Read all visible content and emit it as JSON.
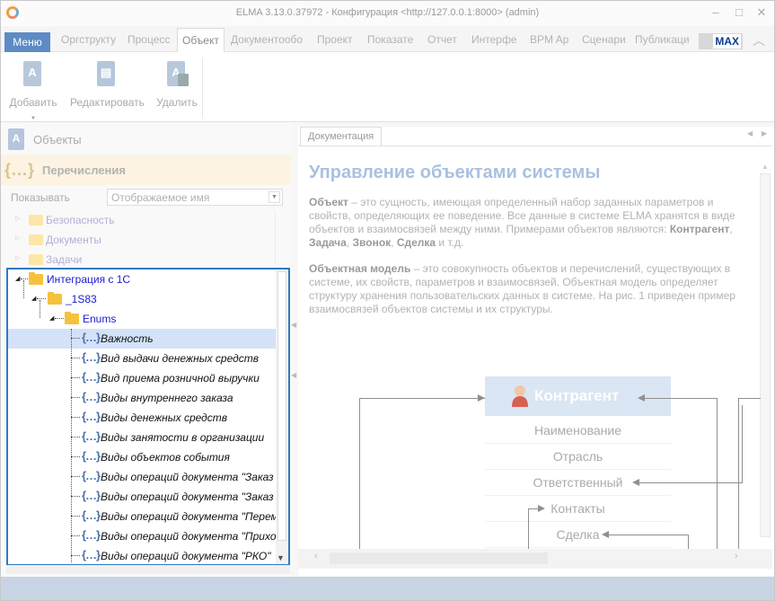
{
  "window": {
    "title": "ELMA 3.13.0.37972 - Конфигурация <http://127.0.0.1:8000> (admin)"
  },
  "menu": {
    "menu_label": "Меню",
    "tabs": [
      "Оргструкту",
      "Процесс",
      "Объект",
      "Документообо",
      "Проект",
      "Показате",
      "Отчет",
      "Интерфе",
      "BPM Ap",
      "Сценари",
      "Публикаци"
    ],
    "active_tab": "Объект",
    "max_label": "MAX"
  },
  "ribbon": {
    "add_label": "Добавить",
    "edit_label": "Редактировать",
    "delete_label": "Удалить"
  },
  "left": {
    "objects_label": "Объекты",
    "enums_label": "Перечисления",
    "show_label": "Показывать",
    "show_value": "Отображаемое имя",
    "faded_items": [
      "Безопасность",
      "Документы",
      "Задачи"
    ],
    "tree": {
      "integration": "Интеграция с 1С",
      "sub": "_1S83",
      "enums_folder": "Enums",
      "items": [
        "Важность",
        "Вид выдачи денежных средств",
        "Вид приема розничной выручки",
        "Виды внутреннего заказа",
        "Виды денежных средств",
        "Виды занятости в организации",
        "Виды объектов события",
        "Виды операций документа \"Заказ п",
        "Виды операций документа \"Заказ п",
        "Виды операций документа \"Перем",
        "Виды операций документа \"Прихо",
        "Виды операций документа \"РКО\""
      ],
      "selected_index": 0
    }
  },
  "right": {
    "tab_label": "Документация",
    "heading": "Управление объектами системы",
    "p1_term": "Объект",
    "p1_text": " – это сущность, имеющая определенный набор заданных параметров и свойств, определяющих ее поведение. Все данные в системе ELMA хранятся в виде объектов и взаимосвязей между ними. Примерами объектов являются: ",
    "p1_ex1": "Контрагент",
    "p1_sep1": ", ",
    "p1_ex2": "Задача",
    "p1_sep2": ", ",
    "p1_ex3": "Звонок",
    "p1_sep3": ", ",
    "p1_ex4": "Сделка",
    "p1_end": " и т.д.",
    "p2_term": "Объектная модель",
    "p2_text": " – это совокупность объектов и перечислений, существующих в системе, их свойств, параметров и взаимосвязей. Объектная модель определяет структуру хранения пользовательских данных в системе. На рис. 1 приведен пример взаимосвязей объектов системы и их структуры.",
    "diagram": {
      "entity": "Контрагент",
      "fields": [
        "Наименование",
        "Отрасль",
        "Ответственный",
        "Контакты",
        "Сделка"
      ]
    }
  },
  "colors": {
    "accent": "#3079bf",
    "menu_button": "#5d8bc4",
    "selection": "#d3e2f8",
    "folder": "#f6c23d"
  }
}
